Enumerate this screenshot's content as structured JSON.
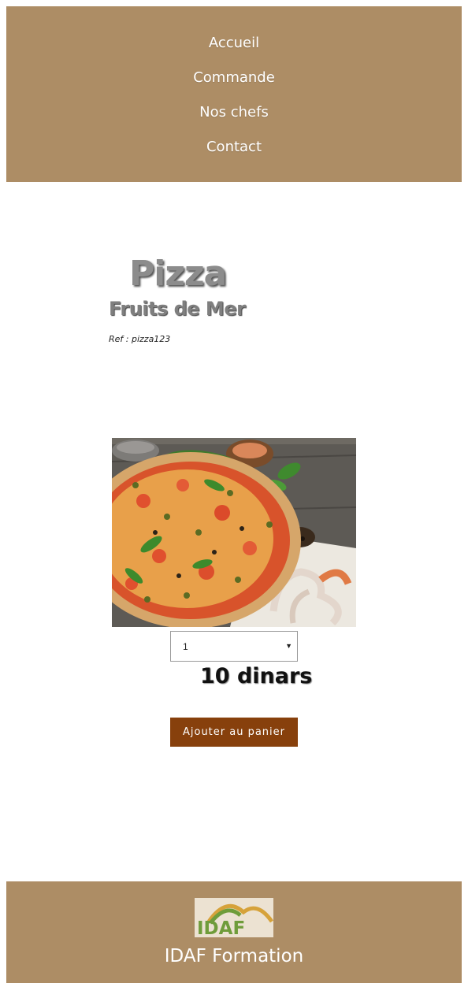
{
  "nav": {
    "items": [
      "Accueil",
      "Commande",
      "Nos chefs",
      "Contact"
    ]
  },
  "product": {
    "title": "Pizza",
    "subtitle": "Fruits de Mer",
    "ref": "Ref : pizza123",
    "image_alt": "pizza-photo",
    "quantity": "1",
    "price": "10 dinars",
    "add_to_cart_label": "Ajouter au panier"
  },
  "footer": {
    "logo_text": "IDAF",
    "brand": "IDAF Formation"
  },
  "colors": {
    "nav_bg": "#ad8d65",
    "button_bg": "#87400c",
    "title_gray": "#8c8c8c"
  }
}
